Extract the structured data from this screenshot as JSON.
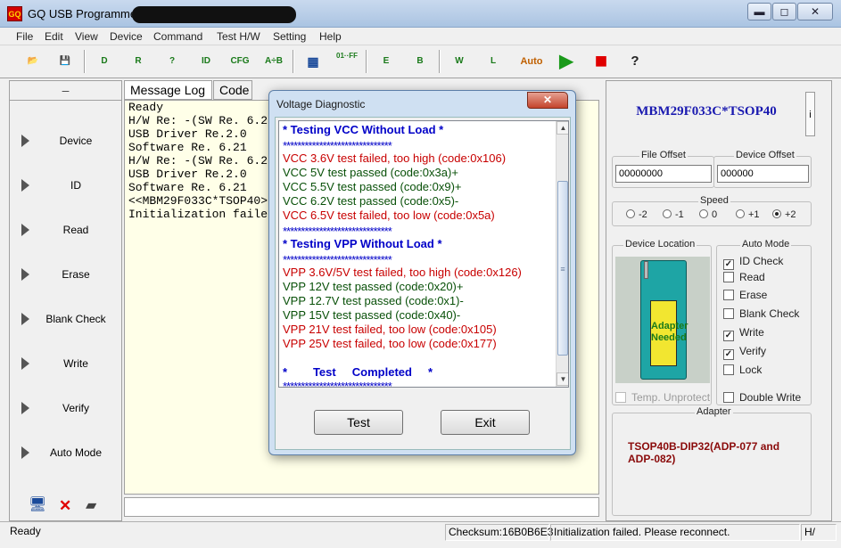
{
  "window": {
    "title": "GQ USB Programmer",
    "app_icon_text": "GQ",
    "minimize": "▬",
    "maximize": "◻",
    "close": "✕"
  },
  "menu": [
    "File",
    "Edit",
    "View",
    "Device",
    "Command",
    "Test H/W",
    "Setting",
    "Help"
  ],
  "toolbar": {
    "buttons": [
      {
        "name": "open-icon",
        "label": "📂"
      },
      {
        "name": "save-icon",
        "label": "💾"
      },
      {
        "name": "device-icon",
        "label": "D"
      },
      {
        "name": "read-icon",
        "label": "R"
      },
      {
        "name": "blank-check-icon",
        "label": "?"
      },
      {
        "name": "id-icon",
        "label": "ID"
      },
      {
        "name": "cfg-icon",
        "label": "CFG"
      },
      {
        "name": "a-to-b-icon",
        "label": "A÷B"
      },
      {
        "name": "calculator-icon",
        "label": "▦"
      },
      {
        "name": "fill-icon",
        "label": "01··FF"
      },
      {
        "name": "erase-icon",
        "label": "E"
      },
      {
        "name": "blank-icon",
        "label": "B"
      },
      {
        "name": "write-icon",
        "label": "W"
      },
      {
        "name": "lock-icon",
        "label": "L"
      },
      {
        "name": "auto-icon",
        "label": "Auto"
      },
      {
        "name": "play-icon",
        "label": "▶"
      },
      {
        "name": "stop-icon",
        "label": "■"
      },
      {
        "name": "help-icon",
        "label": "?"
      }
    ]
  },
  "left_pane": {
    "header": "–",
    "operations": [
      "Device",
      "ID",
      "Read",
      "Erase",
      "Blank Check",
      "Write",
      "Verify",
      "Auto Mode"
    ],
    "status_icons": {
      "computer": "🖥",
      "x": "✕",
      "chip": "▰"
    }
  },
  "tabs": [
    "Message Log",
    "Code"
  ],
  "log_lines": [
    "Ready",
    "H/W Re: -(SW Re. 6.2",
    "USB Driver Re.2.0",
    "Software Re. 6.21",
    "H/W Re: -(SW Re. 6.2",
    "USB Driver Re.2.0",
    "Software Re. 6.21",
    "<<MBM29F033C*TSOP40>",
    "Initialization faile"
  ],
  "right_pane": {
    "chip_name": "MBM29F033C*TSOP40",
    "info_button": "i",
    "file_offset": {
      "label": "File Offset",
      "value": "00000000"
    },
    "device_offset": {
      "label": "Device Offset",
      "value": "000000"
    },
    "speed": {
      "label": "Speed",
      "options": [
        "-2",
        "-1",
        "0",
        "+1",
        "+2"
      ],
      "selected": "+2"
    },
    "device_location": {
      "label": "Device Location",
      "adapter_text": "Adapter Needed"
    },
    "temp_unprotect": {
      "label": "Temp. Unprotect",
      "checked": false,
      "enabled": false
    },
    "auto_mode": {
      "label": "Auto Mode",
      "items": [
        {
          "label": "ID Check",
          "checked": true
        },
        {
          "label": "Read",
          "checked": false
        },
        {
          "label": "Erase",
          "checked": false
        },
        {
          "label": "Blank Check",
          "checked": false
        },
        {
          "label": "Write",
          "checked": true
        },
        {
          "label": "Verify",
          "checked": true
        },
        {
          "label": "Lock",
          "checked": false
        }
      ]
    },
    "double_write": {
      "label": "Double Write",
      "checked": false
    },
    "adapter": {
      "label": "Adapter",
      "text": "TSOP40B-DIP32(ADP-077 and ADP-082)"
    }
  },
  "status_bar": {
    "state": "Ready",
    "checksum": "Checksum:16B0B6E3",
    "message": "Initialization failed. Please reconnect.",
    "hw": "H/"
  },
  "dialog": {
    "title": "Voltage Diagnostic",
    "close": "✕",
    "lines": [
      {
        "text": "* Testing VCC Without Load *",
        "style": "c-blue"
      },
      {
        "text": "******************************",
        "style": "c-stars"
      },
      {
        "text": "VCC 3.6V test failed, too high (code:0x106)",
        "style": "c-red"
      },
      {
        "text": "VCC 5V test passed (code:0x3a)+",
        "style": "c-green"
      },
      {
        "text": "VCC 5.5V test passed (code:0x9)+",
        "style": "c-green"
      },
      {
        "text": "VCC 6.2V test passed (code:0x5)-",
        "style": "c-green"
      },
      {
        "text": "VCC 6.5V test failed, too low (code:0x5a)",
        "style": "c-red"
      },
      {
        "text": "******************************",
        "style": "c-stars"
      },
      {
        "text": "* Testing VPP  Without Load *",
        "style": "c-blue"
      },
      {
        "text": "******************************",
        "style": "c-stars"
      },
      {
        "text": "VPP 3.6V/5V test failed, too high (code:0x126)",
        "style": "c-red"
      },
      {
        "text": "VPP 12V test passed (code:0x20)+",
        "style": "c-green"
      },
      {
        "text": "VPP 12.7V test passed (code:0x1)-",
        "style": "c-green"
      },
      {
        "text": "VPP 15V test passed (code:0x40)-",
        "style": "c-green"
      },
      {
        "text": "VPP 21V test failed, too low (code:0x105)",
        "style": "c-red"
      },
      {
        "text": "VPP 25V test failed, too low (code:0x177)",
        "style": "c-red"
      },
      {
        "text": "",
        "style": "c-green"
      },
      {
        "text": "*        Test     Completed     *",
        "style": "c-blue"
      },
      {
        "text": "******************************",
        "style": "c-stars"
      }
    ],
    "scroll_up": "▲",
    "scroll_down": "▼",
    "scroll_grip": "≡",
    "test_button": "Test",
    "exit_button": "Exit"
  },
  "colors": {
    "accent": "#1a1ab0",
    "fail": "#c80000",
    "pass": "#085008",
    "heading": "#0000c8"
  }
}
